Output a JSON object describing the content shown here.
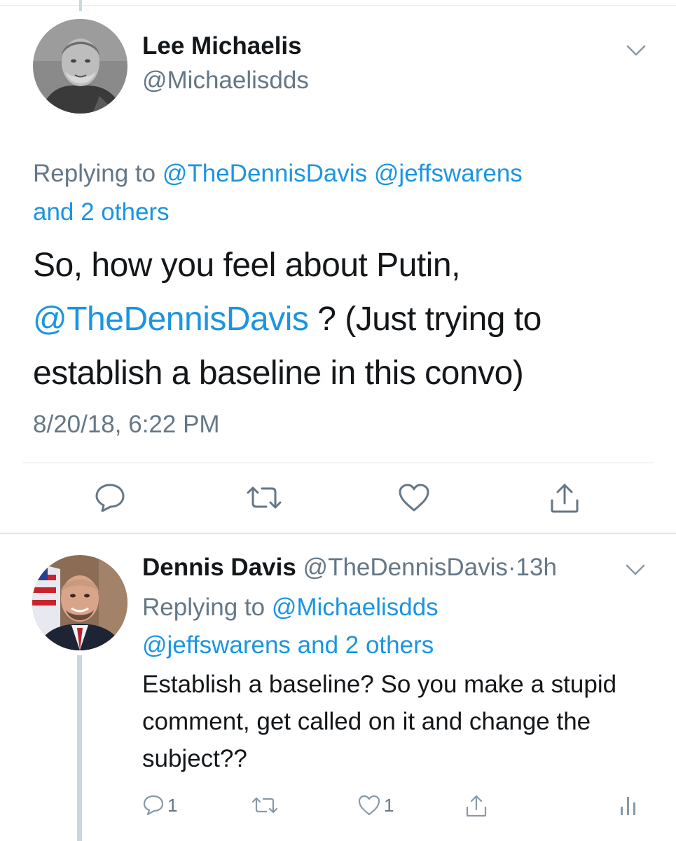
{
  "main_tweet": {
    "author": {
      "name": "Lee Michaelis",
      "handle": "@Michaelisdds"
    },
    "replying_to": {
      "prefix": "Replying to",
      "mention_1": "@TheDennisDavis",
      "mention_2": "@jeffswarens",
      "others": "and 2 others"
    },
    "text": {
      "part_1": "So, how you feel about Putin,",
      "mention": "@TheDennisDavis",
      "part_2": " ? (Just trying to establish a baseline in this convo)"
    },
    "timestamp": "8/20/18, 6:22 PM",
    "actions": [
      {
        "icon": "reply-icon"
      },
      {
        "icon": "retweet-icon"
      },
      {
        "icon": "like-icon"
      },
      {
        "icon": "share-icon"
      }
    ]
  },
  "reply_tweet": {
    "author": {
      "name": "Dennis Davis",
      "handle": "@TheDennisDavis",
      "separator": "·",
      "time": "13h"
    },
    "replying_to": {
      "prefix": "Replying to",
      "mention_1": "@Michaelisdds",
      "mention_2": "@jeffswarens",
      "others": "and 2 others"
    },
    "text": "Establish a baseline? So you make a stupid comment, get called on it and change the subject??",
    "actions": {
      "reply_count": "1",
      "like_count": "1"
    }
  },
  "colors": {
    "link": "#1b95e0",
    "secondary_text": "#657786",
    "primary_text": "#14171a",
    "divider": "#e1e8ed",
    "thread_line": "#ccd6dd"
  }
}
